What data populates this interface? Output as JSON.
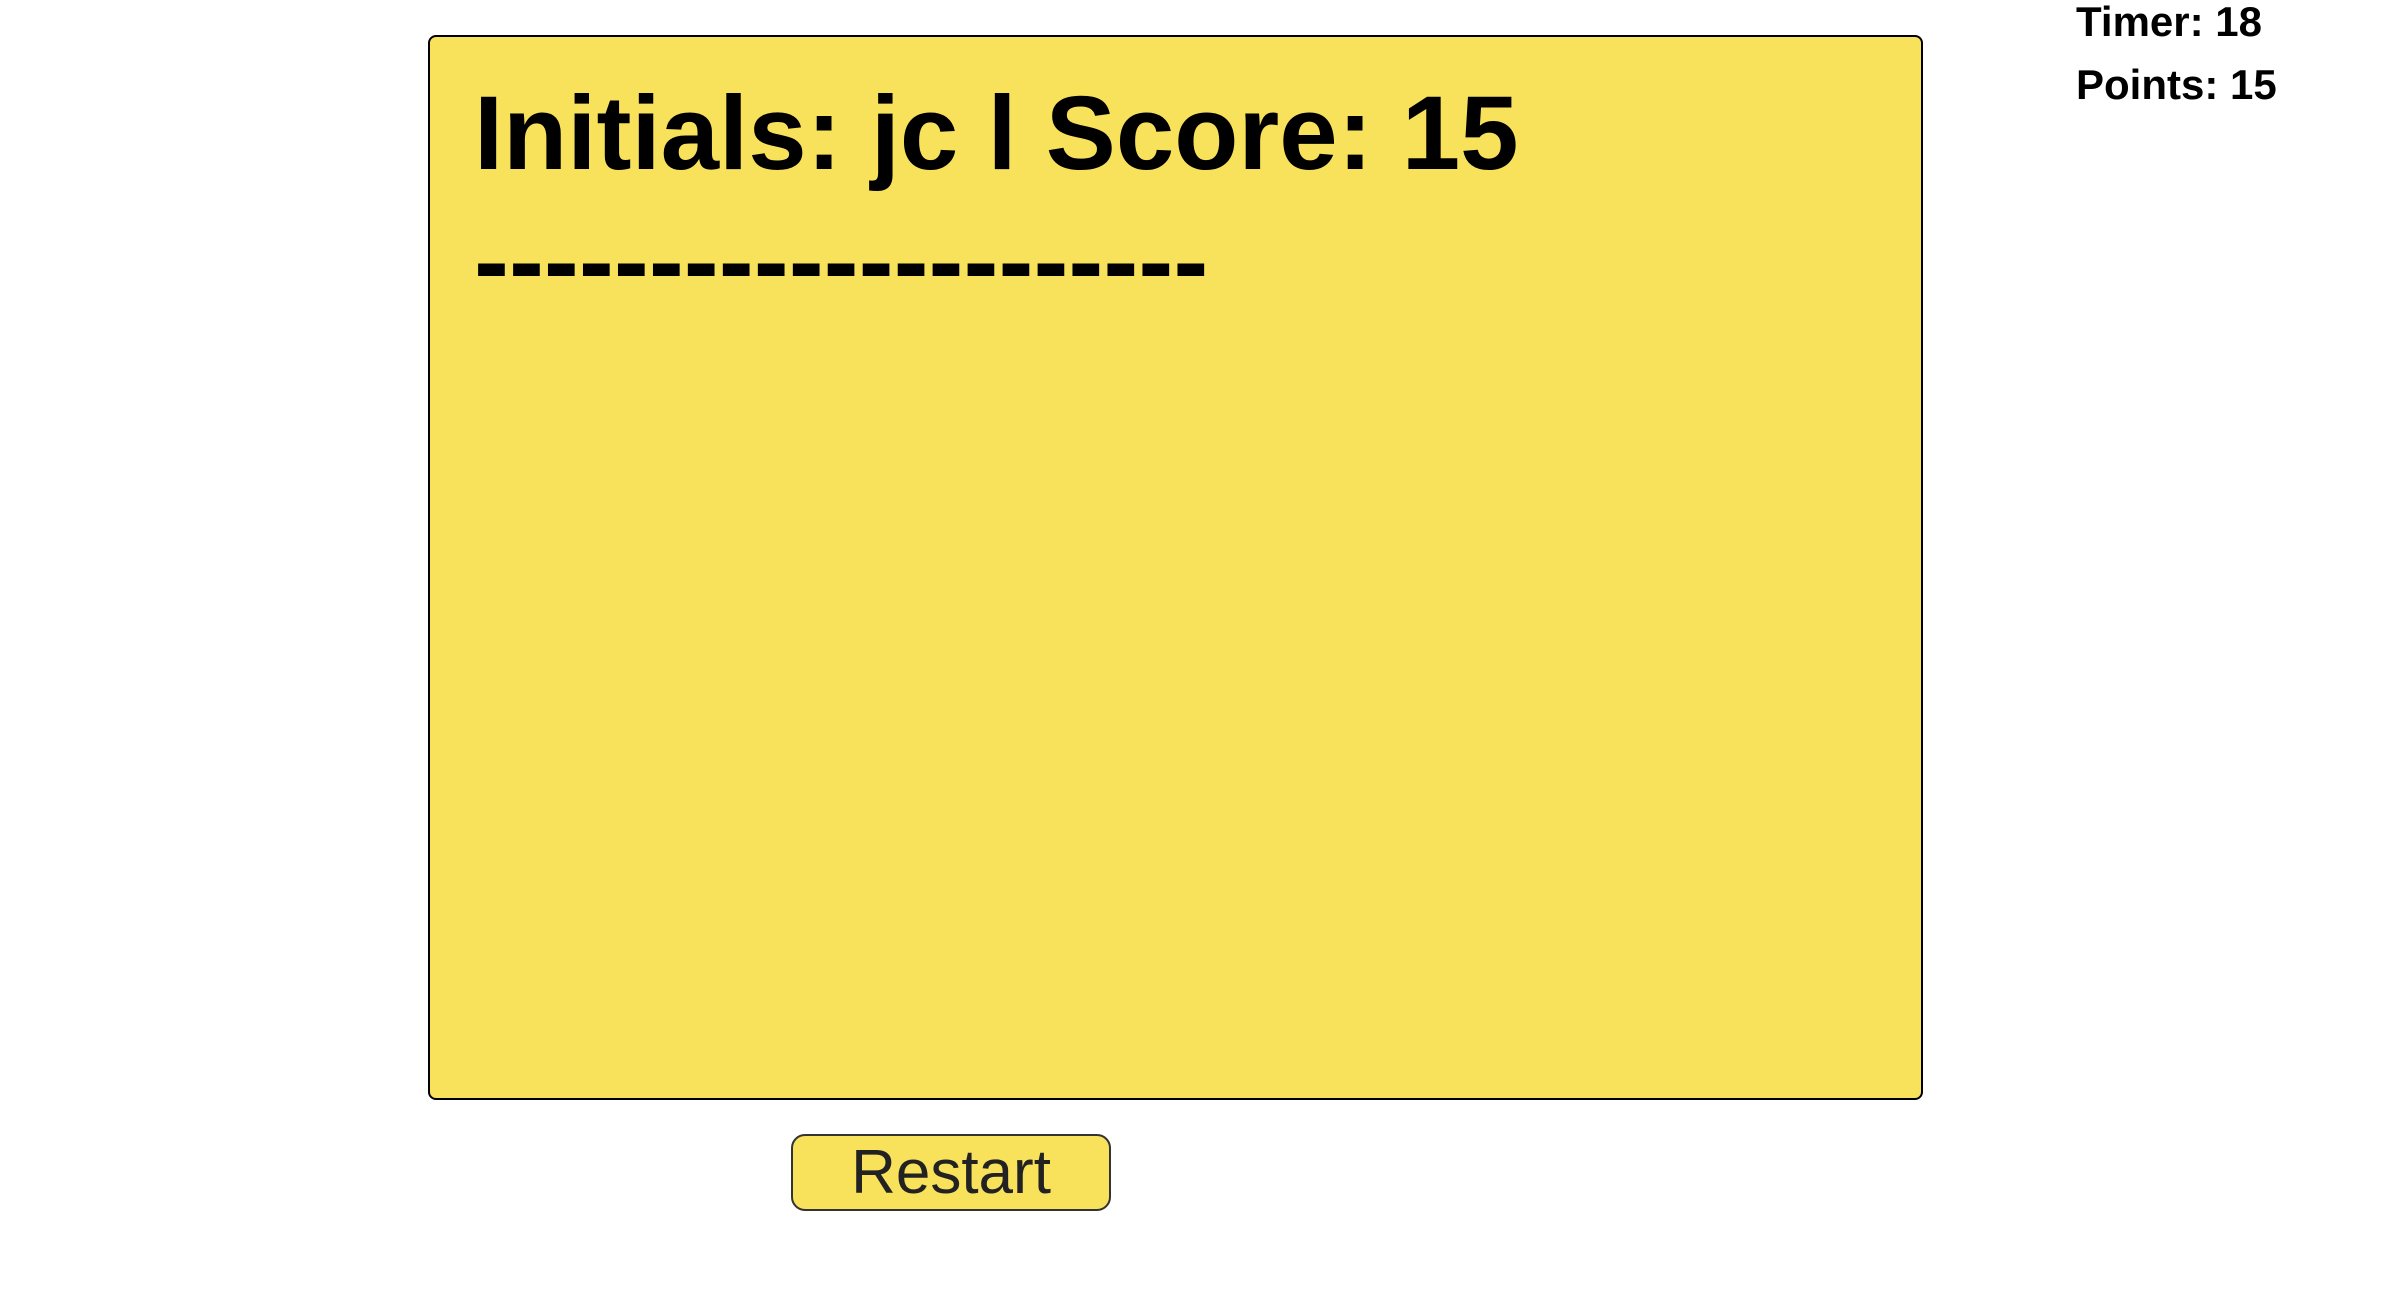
{
  "stats": {
    "timer": "Timer: 18",
    "points": "Points: 15"
  },
  "score_card": {
    "score_line": "Initials: jc l Score: 15",
    "divider": "---------------------"
  },
  "actions": {
    "restart_label": "Restart"
  },
  "colors": {
    "card_background": "#f8e15b",
    "text": "#000000",
    "page_background": "#ffffff"
  }
}
